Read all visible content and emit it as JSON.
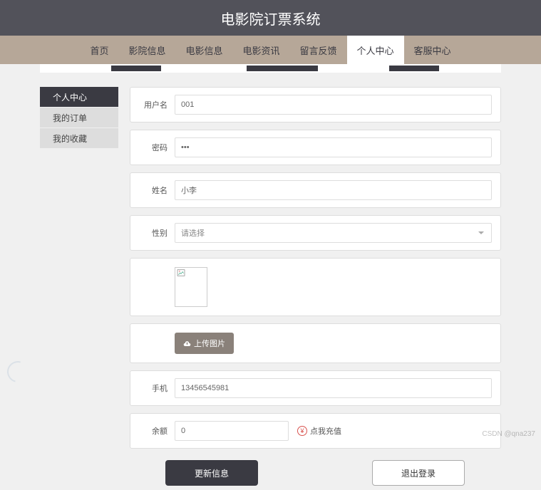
{
  "header": {
    "title": "电影院订票系统"
  },
  "nav": {
    "items": [
      {
        "label": "首页"
      },
      {
        "label": "影院信息"
      },
      {
        "label": "电影信息"
      },
      {
        "label": "电影资讯"
      },
      {
        "label": "留言反馈"
      },
      {
        "label": "个人中心",
        "active": true
      },
      {
        "label": "客服中心"
      }
    ]
  },
  "sidebar": {
    "items": [
      {
        "label": "个人中心",
        "active": true
      },
      {
        "label": "我的订单"
      },
      {
        "label": "我的收藏"
      }
    ]
  },
  "form": {
    "username": {
      "label": "用户名",
      "value": "001"
    },
    "password": {
      "label": "密码",
      "value": "•••"
    },
    "name": {
      "label": "姓名",
      "value": "小李"
    },
    "gender": {
      "label": "性别",
      "placeholder": "请选择"
    },
    "upload": {
      "label": "上传图片"
    },
    "phone": {
      "label": "手机",
      "value": "13456545981"
    },
    "balance": {
      "label": "余额",
      "value": "0",
      "recharge": "点我充值"
    }
  },
  "buttons": {
    "update": "更新信息",
    "logout": "退出登录"
  },
  "watermark": "CSDN @qna237"
}
